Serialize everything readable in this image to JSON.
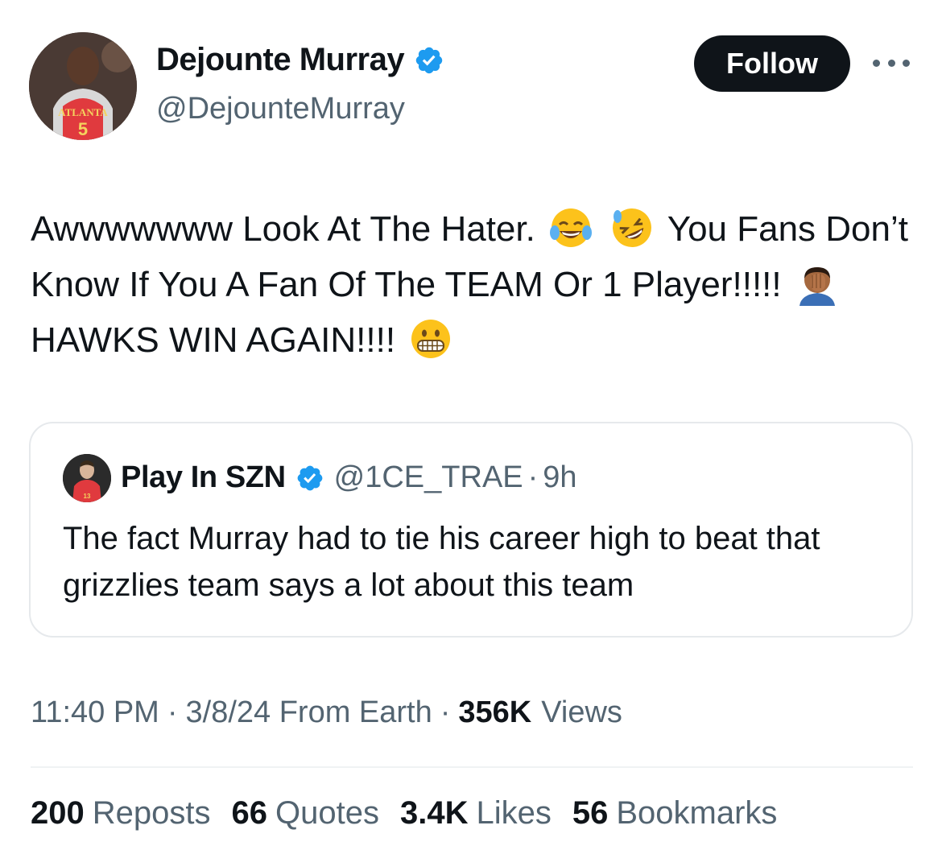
{
  "author": {
    "display_name": "Dejounte Murray",
    "handle": "@DejounteMurray",
    "jersey_text": "ATLANTA",
    "jersey_number": "5"
  },
  "actions": {
    "follow_label": "Follow"
  },
  "tweet": {
    "text_1": "Awwwwwww Look At The Hater.",
    "text_2": "You Fans Don’t Know If You A Fan Of The TEAM Or 1 Player!!!!!",
    "text_3": "HAWKS WIN AGAIN!!!!",
    "emojis": [
      "tears-of-joy-emoji",
      "rolling-laughing-emoji",
      "facepalm-emoji",
      "grimacing-emoji"
    ]
  },
  "quote": {
    "name": "Play In SZN",
    "handle": "@1CE_TRAE",
    "dot": "·",
    "time": "9h",
    "text": "The fact Murray had to tie his career high to beat that grizzlies team says a lot about this team"
  },
  "meta": {
    "time": "11:40 PM",
    "dot": "·",
    "date_source": "3/8/24 From Earth",
    "views_count": "356K",
    "views_label": "Views"
  },
  "stats": [
    {
      "num": "200",
      "label": "Reposts"
    },
    {
      "num": "66",
      "label": "Quotes"
    },
    {
      "num": "3.4K",
      "label": "Likes"
    },
    {
      "num": "56",
      "label": "Bookmarks"
    }
  ],
  "colors": {
    "text": "#0f1419",
    "secondary": "#536471",
    "verified": "#1d9bf0",
    "border": "#e6e9ec",
    "button_bg": "#0f1419",
    "hawks_red": "#e03a3e"
  }
}
